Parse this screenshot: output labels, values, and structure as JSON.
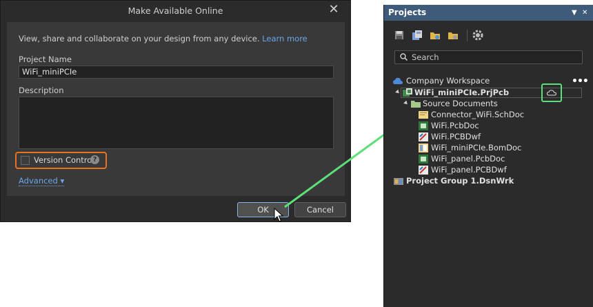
{
  "dialog": {
    "title": "Make Available Online",
    "close_glyph": "✕",
    "intro_text": "View, share and collaborate on your design from any device. ",
    "learn_more": "Learn more",
    "project_name_label": "Project Name",
    "project_name_value": "WiFi_miniPCIe",
    "description_label": "Description",
    "description_value": "",
    "version_control_label": "Version Control",
    "version_control_checked": false,
    "help_glyph": "?",
    "advanced_label": "Advanced ▾",
    "ok_label": "OK",
    "cancel_label": "Cancel",
    "highlight_color": "#e8731e"
  },
  "projects_panel": {
    "title": "Projects",
    "header_pin": "▼",
    "header_close": "✕",
    "toolbar_icons": [
      "save-icon",
      "save-all-icon",
      "open-project-icon",
      "close-project-icon",
      "settings-icon"
    ],
    "search_placeholder": "Search",
    "more_glyph": "•••",
    "tree": [
      {
        "label": "Company Workspace",
        "icon": "cloud-workspace-icon"
      },
      {
        "label": "WiFi_miniPCIe.PrjPcb",
        "icon": "pcb-project-icon",
        "status_icon": "cloud-icon"
      },
      {
        "label": "Source Documents",
        "icon": "folder-icon"
      },
      {
        "label": "Connector_WiFi.SchDoc",
        "icon": "schematic-doc-icon"
      },
      {
        "label": "WiFi.PcbDoc",
        "icon": "pcb-doc-icon"
      },
      {
        "label": "WiFi.PCBDwf",
        "icon": "draftsman-doc-icon"
      },
      {
        "label": "WiFi_miniPCIe.BomDoc",
        "icon": "bom-doc-icon"
      },
      {
        "label": "WiFi_panel.PcbDoc",
        "icon": "pcb-doc-icon"
      },
      {
        "label": "WiFi_panel.PCBDwf",
        "icon": "draftsman-doc-icon"
      },
      {
        "label": "Project Group 1.DsnWrk",
        "icon": "project-group-icon"
      }
    ],
    "highlight_color": "#5be07a"
  },
  "callout_arrow_color": "#5be07a"
}
